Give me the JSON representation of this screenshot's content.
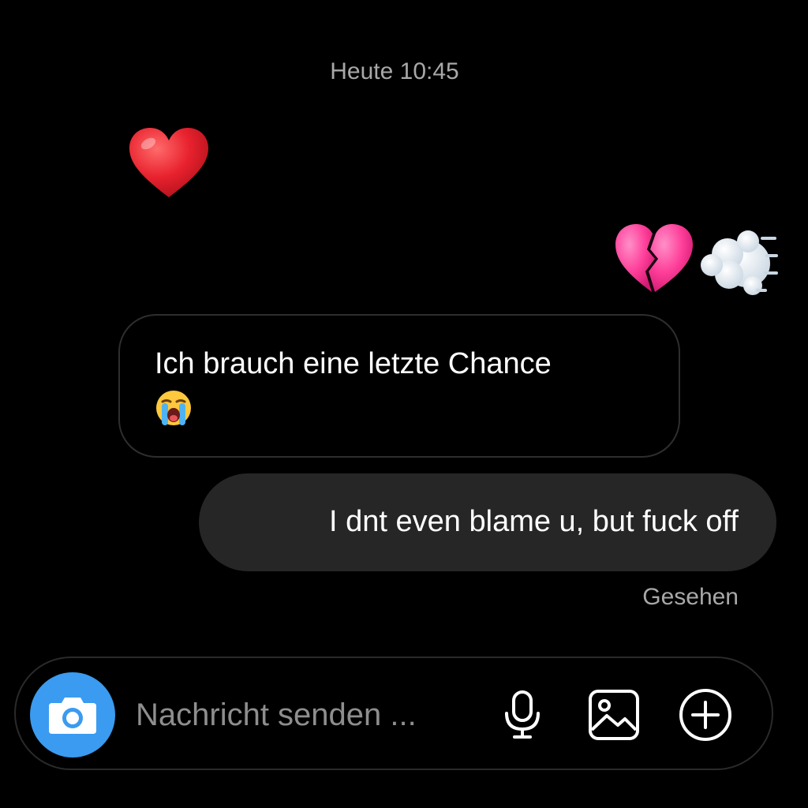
{
  "header": {
    "timestamp": "Heute 10:45"
  },
  "messages": [
    {
      "direction": "incoming",
      "type": "emoji",
      "content": "heart",
      "icon": "red-heart-emoji"
    },
    {
      "direction": "outgoing",
      "type": "emoji",
      "content": "broken-heart dash",
      "icon": "broken-heart-and-dash-emoji"
    },
    {
      "direction": "incoming",
      "type": "text",
      "text": "Ich brauch eine letzte Chance",
      "icon": "loudly-crying-face-emoji"
    },
    {
      "direction": "outgoing",
      "type": "text",
      "text": "I dnt even blame u, but fuck off"
    }
  ],
  "status": {
    "seen_label": "Gesehen"
  },
  "composer": {
    "placeholder": "Nachricht senden ...",
    "value": "",
    "icons": [
      "camera-icon",
      "microphone-icon",
      "gallery-icon",
      "plus-icon"
    ]
  },
  "colors": {
    "background": "#000000",
    "outgoing_bubble": "#262626",
    "incoming_border": "#2e2e2e",
    "camera_button": "#3a9bf0",
    "muted_text": "#a8a8a8",
    "heart_red": "#e8222e",
    "broken_heart_pink": "#ff3f9a"
  }
}
